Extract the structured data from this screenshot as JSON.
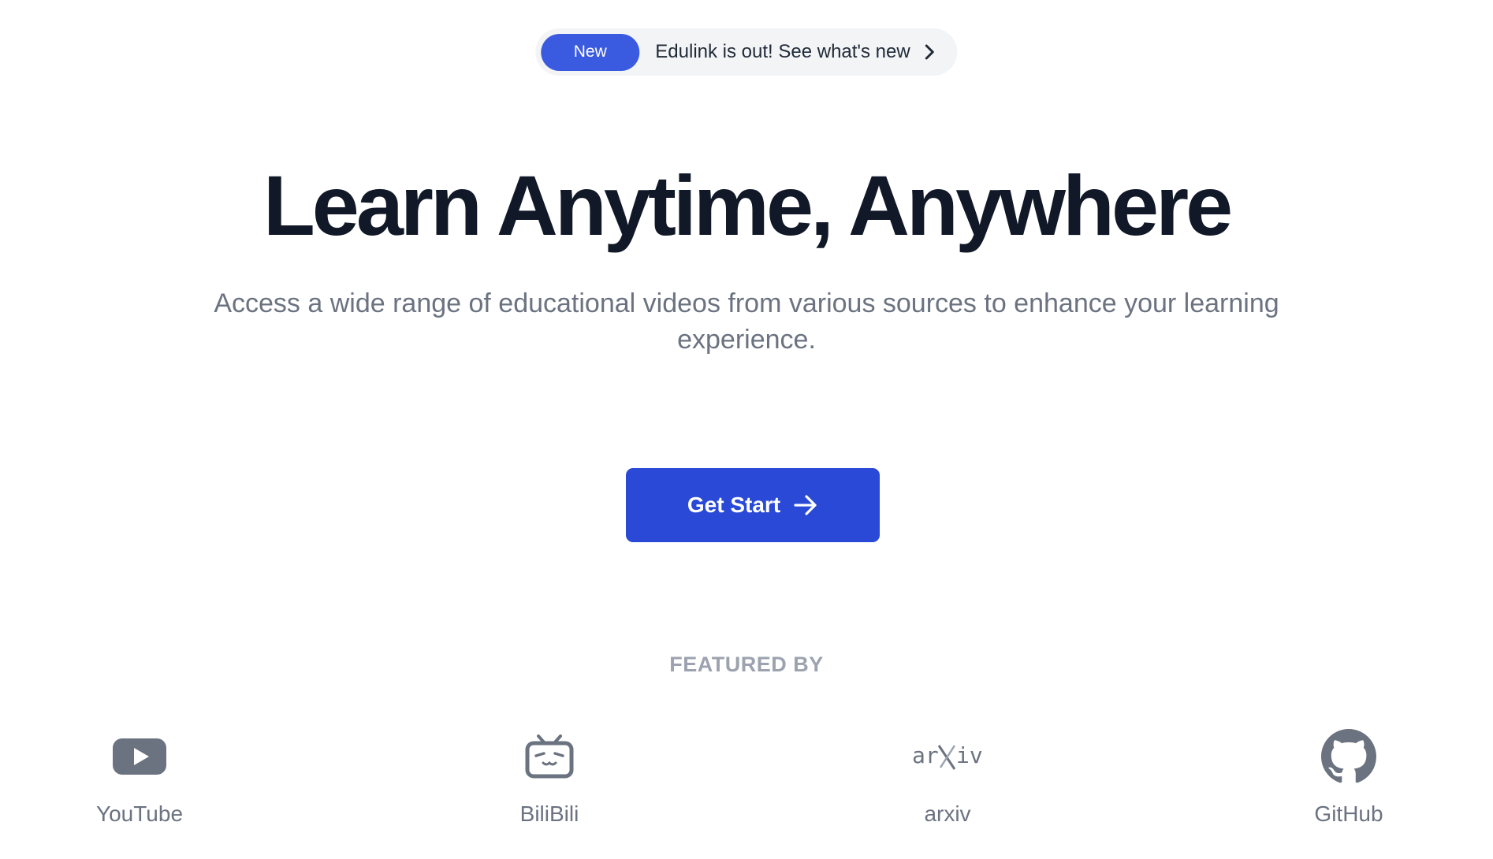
{
  "announcement": {
    "badge": "New",
    "message": "Edulink is out! See what's new"
  },
  "hero": {
    "title": "Learn Anytime, Anywhere",
    "subtitle": "Access a wide range of educational videos from various sources to enhance your learning experience."
  },
  "cta": {
    "label": "Get Start"
  },
  "featured": {
    "heading": "FEATURED BY",
    "sources": [
      {
        "name": "YouTube",
        "icon": "youtube-icon"
      },
      {
        "name": "BiliBili",
        "icon": "bilibili-icon"
      },
      {
        "name": "arxiv",
        "icon": "arxiv-logo",
        "logo_text": "arXiv"
      },
      {
        "name": "GitHub",
        "icon": "github-icon"
      }
    ]
  },
  "colors": {
    "accent": "#2949d6",
    "badge": "#3a5ae0",
    "title": "#111827",
    "muted": "#6b7280"
  }
}
